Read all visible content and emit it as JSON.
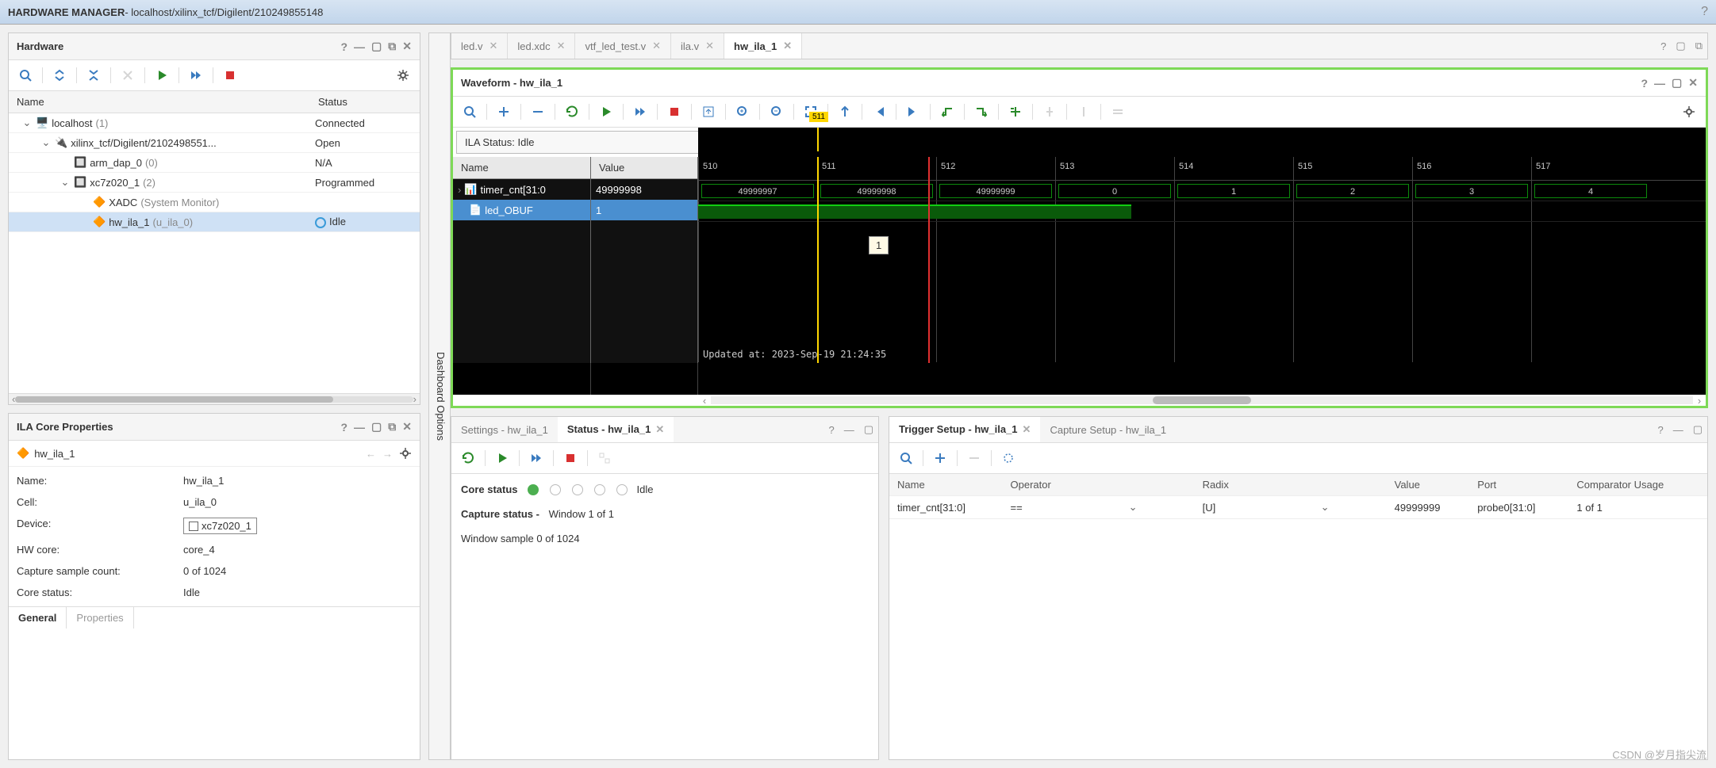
{
  "title": {
    "main": "HARDWARE MANAGER",
    "sub": " - localhost/xilinx_tcf/Digilent/210249855148"
  },
  "hardware_panel": {
    "title": "Hardware",
    "cols": {
      "name": "Name",
      "status": "Status"
    },
    "tree": [
      {
        "indent": 0,
        "expand": "⌄",
        "name": "localhost",
        "suffix": "(1)",
        "status": "Connected",
        "icon": "server-icon"
      },
      {
        "indent": 1,
        "expand": "⌄",
        "name": "xilinx_tcf/Digilent/2102498551...",
        "suffix": "",
        "status": "Open",
        "icon": "cable-icon"
      },
      {
        "indent": 2,
        "expand": "",
        "name": "arm_dap_0",
        "suffix": "(0)",
        "status": "N/A",
        "icon": "chip-icon"
      },
      {
        "indent": 2,
        "expand": "⌄",
        "name": "xc7z020_1",
        "suffix": "(2)",
        "status": "Programmed",
        "icon": "chip-icon"
      },
      {
        "indent": 3,
        "expand": "",
        "name": "XADC",
        "suffix": "(System Monitor)",
        "status": "",
        "icon": "core-icon"
      },
      {
        "indent": 3,
        "expand": "",
        "name": "hw_ila_1",
        "suffix": "(u_ila_0)",
        "status": "Idle",
        "icon": "core-icon",
        "selected": true,
        "status_idle": true
      }
    ]
  },
  "props_panel": {
    "title": "ILA Core Properties",
    "object": "hw_ila_1",
    "rows": [
      {
        "label": "Name:",
        "value": "hw_ila_1"
      },
      {
        "label": "Cell:",
        "value": "u_ila_0"
      },
      {
        "label": "Device:",
        "value": "xc7z020_1",
        "device_box": true
      },
      {
        "label": "HW core:",
        "value": "core_4"
      },
      {
        "label": "Capture sample count:",
        "value": "0 of 1024"
      },
      {
        "label": "Core status:",
        "value": "Idle"
      }
    ],
    "tabs": [
      {
        "label": "General",
        "active": true
      },
      {
        "label": "Properties",
        "active": false
      }
    ]
  },
  "dashboard_options_label": "Dashboard Options",
  "file_tabs": [
    {
      "label": "led.v",
      "active": false
    },
    {
      "label": "led.xdc",
      "active": false
    },
    {
      "label": "vtf_led_test.v",
      "active": false
    },
    {
      "label": "ila.v",
      "active": false
    },
    {
      "label": "hw_ila_1",
      "active": true
    }
  ],
  "waveform": {
    "title": "Waveform - hw_ila_1",
    "ila_status": "ILA Status: Idle",
    "signal_header": "Name",
    "value_header": "Value",
    "signals": [
      {
        "name": "timer_cnt[31:0",
        "value": "49999998",
        "selected": false
      },
      {
        "name": "led_OBUF",
        "value": "1",
        "selected": true
      }
    ],
    "ticks": [
      "510",
      "511",
      "512",
      "513",
      "514",
      "515",
      "516",
      "517"
    ],
    "marker_yellow": "511",
    "bus_values": [
      "49999997",
      "49999998",
      "49999999",
      "0",
      "1",
      "2",
      "3",
      "4"
    ],
    "tooltip": "1",
    "updated_at": "Updated at: 2023-Sep-19 21:24:35"
  },
  "status_panel": {
    "tabs": [
      {
        "label": "Settings - hw_ila_1",
        "active": false
      },
      {
        "label": "Status - hw_ila_1",
        "active": true
      }
    ],
    "core_status_label": "Core status",
    "core_status_text": "Idle",
    "capture_status_label": "Capture status -",
    "capture_status_value": "Window 1 of 1",
    "window_sample": "Window sample 0 of 1024"
  },
  "trigger_panel": {
    "tabs": [
      {
        "label": "Trigger Setup - hw_ila_1",
        "active": true
      },
      {
        "label": "Capture Setup - hw_ila_1",
        "active": false
      }
    ],
    "cols": [
      "Name",
      "Operator",
      "Radix",
      "Value",
      "Port",
      "Comparator Usage"
    ],
    "row": {
      "name": "timer_cnt[31:0]",
      "operator": "==",
      "radix": "[U]",
      "value": "49999999",
      "port": "probe0[31:0]",
      "usage": "1 of 1"
    }
  },
  "watermark": "CSDN @岁月指尖流"
}
